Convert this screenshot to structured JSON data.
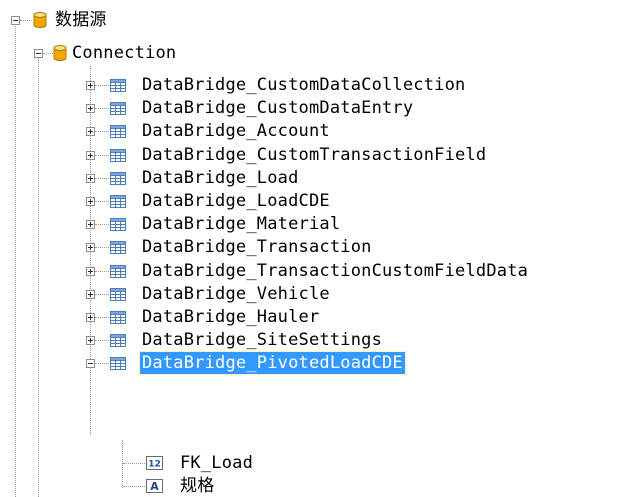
{
  "tree": {
    "root": {
      "label": "数据源",
      "icon": "database-icon"
    },
    "connection": {
      "label": "Connection",
      "icon": "database-icon"
    },
    "tables": [
      {
        "label": "DataBridge_CustomDataCollection",
        "expanded": false
      },
      {
        "label": "DataBridge_CustomDataEntry",
        "expanded": false
      },
      {
        "label": "DataBridge_Account",
        "expanded": false
      },
      {
        "label": "DataBridge_CustomTransactionField",
        "expanded": false
      },
      {
        "label": "DataBridge_Load",
        "expanded": false
      },
      {
        "label": "DataBridge_LoadCDE",
        "expanded": false
      },
      {
        "label": "DataBridge_Material",
        "expanded": false
      },
      {
        "label": "DataBridge_Transaction",
        "expanded": false
      },
      {
        "label": "DataBridge_TransactionCustomFieldData",
        "expanded": false
      },
      {
        "label": "DataBridge_Vehicle",
        "expanded": false
      },
      {
        "label": "DataBridge_Hauler",
        "expanded": false
      },
      {
        "label": "DataBridge_SiteSettings",
        "expanded": false
      },
      {
        "label": "DataBridge_PivotedLoadCDE",
        "expanded": true,
        "selected": true
      }
    ],
    "fields": [
      {
        "label": "FK_Load",
        "icon": "numeric-field-icon",
        "badge": "12"
      },
      {
        "label": "规格",
        "icon": "text-field-icon",
        "badge": "A"
      }
    ],
    "colors": {
      "selection": "#3399ff",
      "db_icon": "#f0a800",
      "table_icon": "#4a7ebb"
    }
  }
}
